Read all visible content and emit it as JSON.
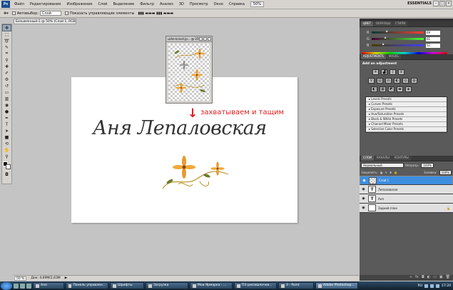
{
  "menubar": {
    "logo": "Ps",
    "items": [
      "Файл",
      "Редактирование",
      "Изображение",
      "Слой",
      "Выделение",
      "Фильтр",
      "Анализ",
      "3D",
      "Просмотр",
      "Окно",
      "Справка"
    ],
    "zoom": "50%",
    "workspace": "ESSENTIALS"
  },
  "options": {
    "autoselect_label": "Автовыбор:",
    "autoselect_value": "Слой",
    "transform_label": "Показать управляющие элементы"
  },
  "document": {
    "tab_title": "Безымянный-1 @ 50% (Слой 1, RGB/8) *",
    "signature": "Аня Лепаловская",
    "instruction": "захватываем и тащим",
    "status_zoom": "50 %",
    "status_doc": "Док: 4,69М/2,63М"
  },
  "float_window": {
    "title": "uzhe-knivel.jp... @ 25%..."
  },
  "color_panel": {
    "tabs": [
      "ЦВЕТ",
      "ОБРАЗЦЫ",
      "СТИЛИ"
    ],
    "rows": [
      {
        "label": "R",
        "value": "69",
        "knob": 0.27
      },
      {
        "label": "G",
        "value": "61",
        "knob": 0.24
      },
      {
        "label": "B",
        "value": "52",
        "knob": 0.2
      }
    ]
  },
  "adjustments": {
    "tabs": [
      "ADJUSTMENTS",
      "MASKS"
    ],
    "title": "Add an adjustment",
    "presets": [
      "Levels Presets",
      "Curves Presets",
      "Exposure Presets",
      "Hue/Saturation Presets",
      "Black & White Presets",
      "Channel Mixer Presets",
      "Selective Color Presets"
    ]
  },
  "layers": {
    "tabs": [
      "СЛОИ",
      "КАНАЛЫ",
      "КОНТУРЫ"
    ],
    "blend_mode": "Нормальный",
    "opacity_label": "Непрозр.:",
    "opacity_value": "100%",
    "lock_label": "Закрепить:",
    "fill_label": "Заливка:",
    "fill_value": "100%",
    "items": [
      {
        "name": "Слой 1",
        "thumb": "",
        "selected": true
      },
      {
        "name": "Лепаловская",
        "thumb": "T",
        "selected": false
      },
      {
        "name": "Аня",
        "thumb": "T",
        "selected": false
      },
      {
        "name": "Задний план",
        "thumb": "",
        "selected": false
      }
    ]
  },
  "taskbar": {
    "tasks": [
      "Аня",
      "Панель управлен...",
      "Шрифты",
      "Загрузка",
      "Мои Ярмарка - ...",
      "ПЭ рисовалочки...",
      "3 - Paint",
      "Adobe Photoshop..."
    ],
    "lang": "RU",
    "time": "17:20"
  }
}
